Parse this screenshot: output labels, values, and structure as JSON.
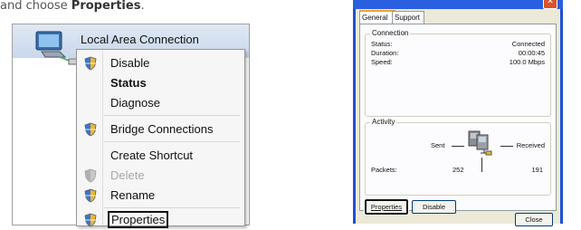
{
  "instruction": {
    "prefix": "and choose ",
    "emphasis": "Properties",
    "suffix": "."
  },
  "context": {
    "connection_name": "Local Area Connection",
    "menu": [
      {
        "label": "Disable",
        "icon": "shield-icon",
        "style": "normal"
      },
      {
        "label": "Status",
        "icon": "",
        "style": "bold"
      },
      {
        "label": "Diagnose",
        "icon": "",
        "style": "normal"
      },
      {
        "label": "Bridge Connections",
        "icon": "shield-icon",
        "style": "normal"
      },
      {
        "label": "Create Shortcut",
        "icon": "",
        "style": "normal"
      },
      {
        "label": "Delete",
        "icon": "shield-icon",
        "style": "disabled"
      },
      {
        "label": "Rename",
        "icon": "shield-icon",
        "style": "normal"
      },
      {
        "label": "Properties",
        "icon": "shield-icon",
        "style": "highlighted"
      }
    ]
  },
  "dialog": {
    "tabs": {
      "general": "General",
      "support": "Support"
    },
    "connection": {
      "title": "Connection",
      "status_label": "Status:",
      "status_value": "Connected",
      "duration_label": "Duration:",
      "duration_value": "00:00:45",
      "speed_label": "Speed:",
      "speed_value": "100.0 Mbps"
    },
    "activity": {
      "title": "Activity",
      "sent": "Sent",
      "received": "Received",
      "packets_label": "Packets:",
      "packets_sent": "252",
      "packets_received": "191"
    },
    "buttons": {
      "properties": "Properties",
      "disable": "Disable",
      "close": "Close"
    }
  },
  "colors": {
    "accent_blue": "#1f4fd6",
    "dialog_face": "#ece9d8",
    "menu_bg": "#f6f6f6"
  }
}
